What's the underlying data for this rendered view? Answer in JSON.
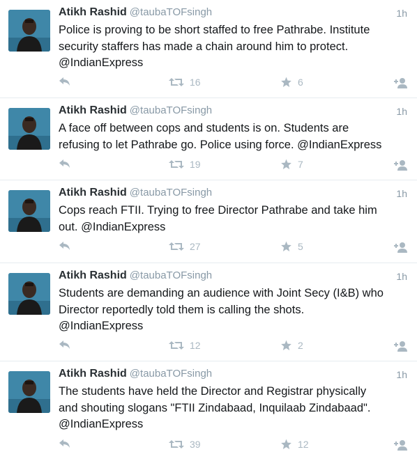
{
  "tweets": [
    {
      "name": "Atikh Rashid",
      "handle": "@taubaTOFsingh",
      "time": "1h",
      "lines": [
        "Police is proving to be short staffed to free Pathrabe.  Institute",
        "security staffers has made a chain around him to protect.",
        "@IndianExpress"
      ],
      "retweets": "16",
      "favorites": "6"
    },
    {
      "name": "Atikh Rashid",
      "handle": "@taubaTOFsingh",
      "time": "1h",
      "lines": [
        "A face off between cops and students is on.  Students are",
        "refusing to let Pathrabe go.  Police using force.  @IndianExpress"
      ],
      "retweets": "19",
      "favorites": "7"
    },
    {
      "name": "Atikh Rashid",
      "handle": "@taubaTOFsingh",
      "time": "1h",
      "lines": [
        "Cops reach FTII.  Trying to free Director Pathrabe and take him",
        "out.  @IndianExpress"
      ],
      "retweets": "27",
      "favorites": "5"
    },
    {
      "name": "Atikh Rashid",
      "handle": "@taubaTOFsingh",
      "time": "1h",
      "lines": [
        "Students are demanding an audience with Joint Secy (I&B)  who",
        "Director reportedly told them is calling the shots.",
        "@IndianExpress"
      ],
      "retweets": "12",
      "favorites": "2"
    },
    {
      "name": "Atikh Rashid",
      "handle": "@taubaTOFsingh",
      "time": "1h",
      "lines": [
        "The students have held the Director and Registrar physically",
        "and shouting slogans \"FTII Zindabaad,  Inquilaab Zindabaad\".",
        "@IndianExpress"
      ],
      "retweets": "39",
      "favorites": "12"
    }
  ],
  "icons": {
    "reply": "reply-icon",
    "retweet": "retweet-icon",
    "favorite": "star-icon",
    "follow": "follow-icon",
    "avatar": "avatar"
  }
}
